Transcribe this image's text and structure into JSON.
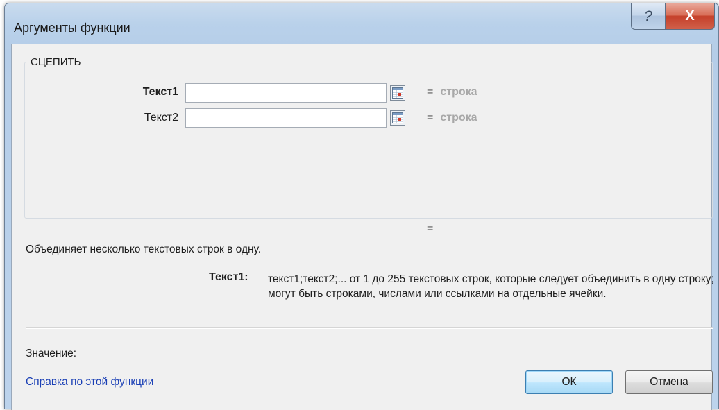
{
  "window": {
    "title": "Аргументы функции",
    "help_glyph": "?",
    "close_glyph": "X"
  },
  "function": {
    "name": "СЦЕПИТЬ",
    "args": [
      {
        "label": "Текст1",
        "bold": true,
        "value": "",
        "eq": "=",
        "result": "строка"
      },
      {
        "label": "Текст2",
        "bold": false,
        "value": "",
        "eq": "=",
        "result": "строка"
      }
    ],
    "result_eq": "=",
    "description": "Объединяет несколько текстовых строк в одну.",
    "arg_help": {
      "label": "Текст1:",
      "text": "текст1;текст2;... от 1 до 255 текстовых строк, которые следует объединить в одну строку; могут быть строками, числами или ссылками на отдельные ячейки."
    }
  },
  "footer": {
    "value_label": "Значение:",
    "help_link": "Справка по этой функции",
    "ok_label": "ОК",
    "cancel_label": "Отмена"
  },
  "colors": {
    "link": "#1a3fb5",
    "result_gray": "#a8a8a8",
    "close_red": "#c5402a"
  }
}
